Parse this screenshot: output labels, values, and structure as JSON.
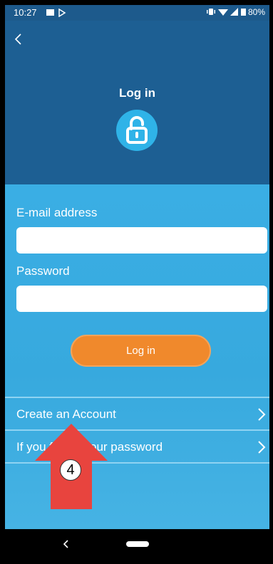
{
  "status_bar": {
    "time": "10:27",
    "battery": "80%"
  },
  "header": {
    "title": "Log in"
  },
  "form": {
    "email_label": "E-mail address",
    "email_value": "",
    "password_label": "Password",
    "password_value": "",
    "login_label": "Log in"
  },
  "links": [
    {
      "label": "Create an Account"
    },
    {
      "label": "If you forgot your password"
    }
  ],
  "annotation": {
    "number": "4"
  },
  "colors": {
    "header": "#1d5f93",
    "body": "#3aaee4",
    "button": "#f0892c",
    "lock": "#2fb3e8",
    "arrow": "#e8443e"
  }
}
